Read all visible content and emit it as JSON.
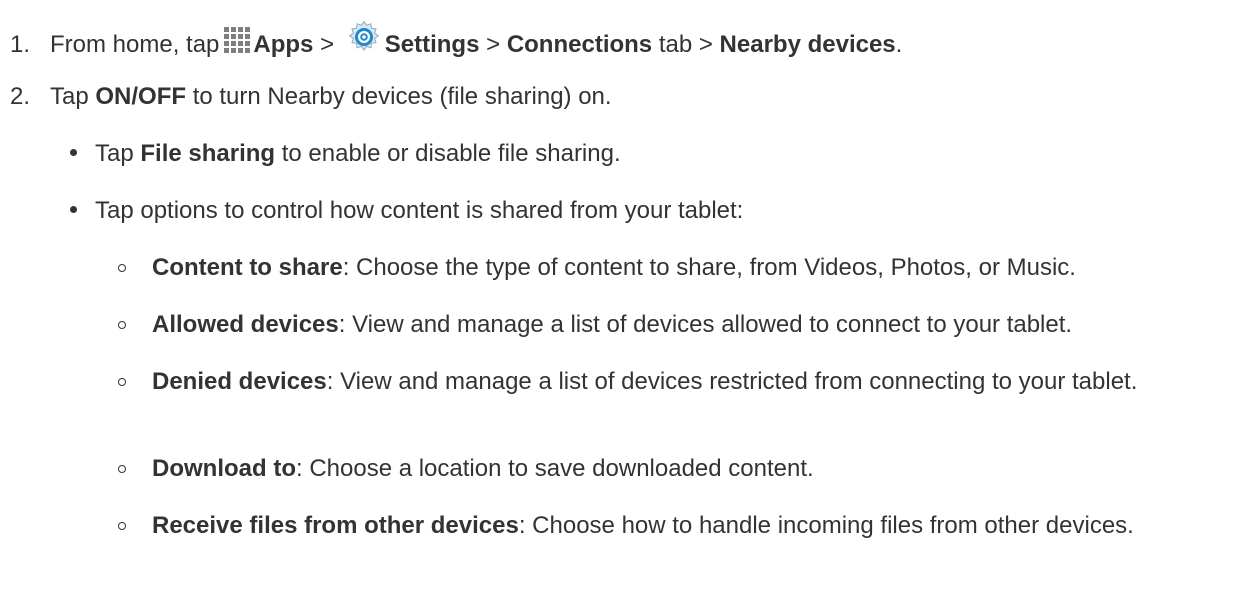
{
  "steps": [
    {
      "num": "1.",
      "t1": "From home, tap",
      "apps": "Apps",
      "sep1": " > ",
      "settings": "Settings",
      "sep2": " > ",
      "connections": "Connections",
      "t2": " tab > ",
      "nearby": "Nearby devices",
      "t3": "."
    },
    {
      "num": "2.",
      "t1": "Tap ",
      "onoff": "ON/OFF",
      "t2": " to turn Nearby devices (file sharing) on."
    }
  ],
  "bullets": [
    {
      "t1": "Tap ",
      "bold": "File sharing",
      "t2": " to enable or disable file sharing."
    },
    {
      "t1": "Tap options to control how content is shared from your tablet:"
    }
  ],
  "options": [
    {
      "label": "Content to share",
      "desc": ": Choose the type of content to share, from Videos, Photos, or Music."
    },
    {
      "label": "Allowed devices",
      "desc": ": View and manage a list of devices allowed to connect to your tablet."
    },
    {
      "label": "Denied devices",
      "desc": ": View and manage a list of devices restricted from connecting to your tablet."
    },
    {
      "label": "Download to",
      "desc": ": Choose a location to save downloaded content."
    },
    {
      "label": "Receive files from other devices",
      "desc": ": Choose how to handle incoming files from other devices."
    }
  ],
  "icons": {
    "apps": "apps-grid-icon",
    "settings": "settings-gear-icon"
  },
  "colors": {
    "text": "#333333",
    "settings_blue": "#1f88c9"
  }
}
